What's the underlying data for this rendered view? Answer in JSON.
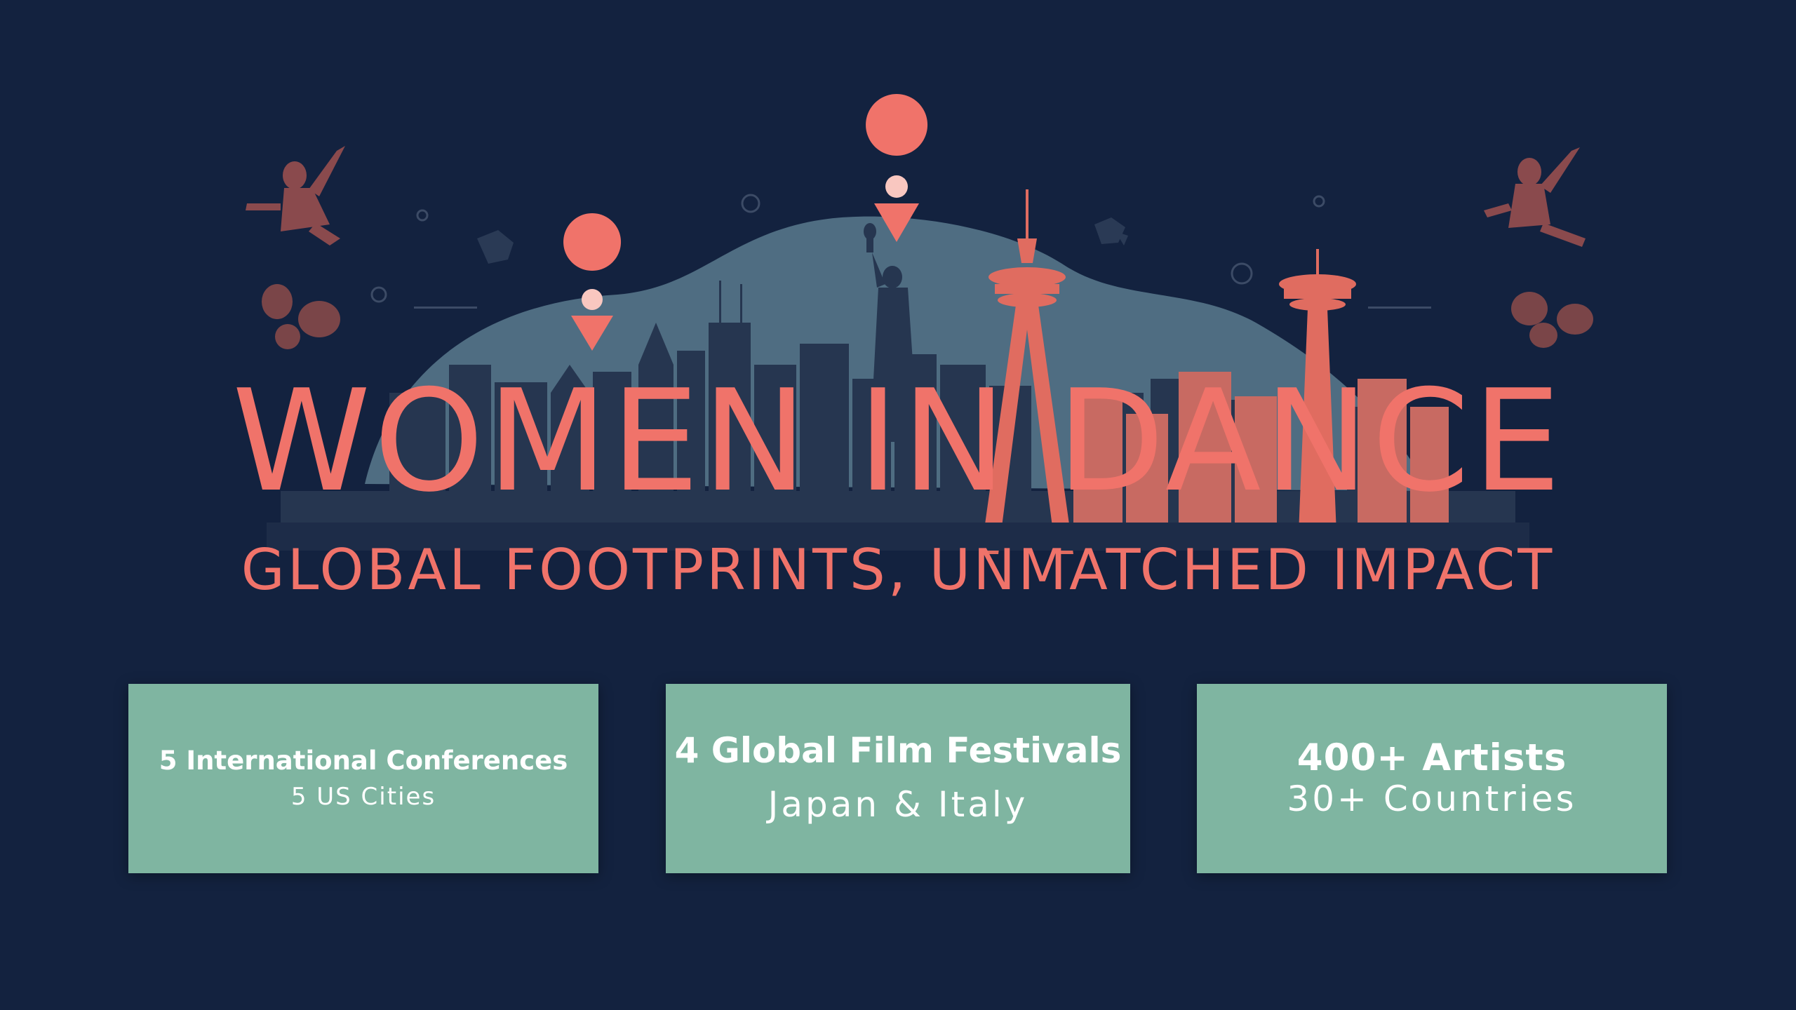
{
  "title": "WOMEN IN DANCE",
  "subtitle": "GLOBAL FOOTPRINTS, UNMATCHED IMPACT",
  "cards": [
    {
      "heading": "5 International Conferences",
      "detail": "5 US Cities"
    },
    {
      "heading": "4 Global Film Festivals",
      "detail": "Japan & Italy"
    },
    {
      "heading": "400+ Artists",
      "detail": "30+ Countries"
    }
  ],
  "colors": {
    "background": "#13223f",
    "accent": "#f0736a",
    "dome": "#4f6d82",
    "skyline": "#263650",
    "card": "#7fb5a1",
    "card_text": "#ffffff"
  },
  "icons": [
    "map-pin-icon",
    "statue-of-liberty-icon",
    "space-needle-icon",
    "dancer-silhouette-icon",
    "world-map-icon"
  ]
}
